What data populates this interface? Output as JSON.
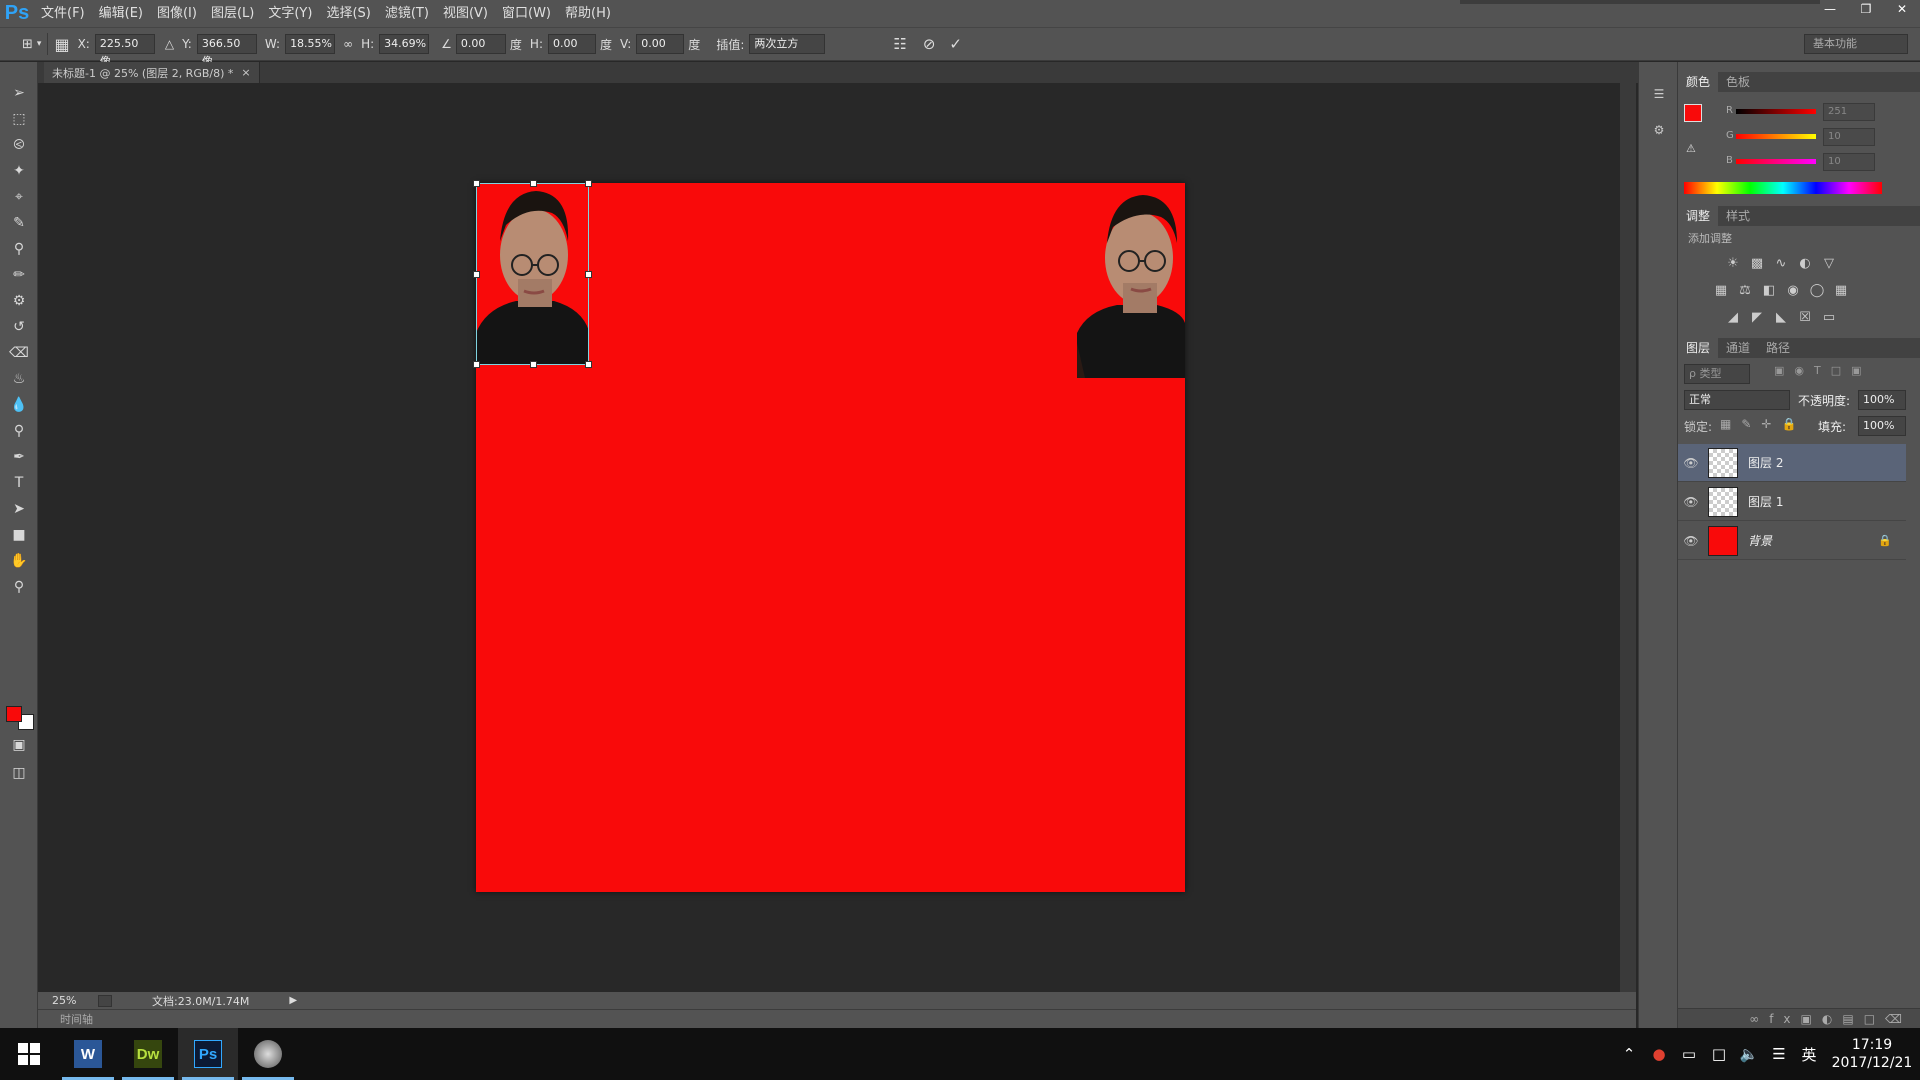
{
  "app": {
    "logo": "Ps"
  },
  "menu": [
    "文件(F)",
    "编辑(E)",
    "图像(I)",
    "图层(L)",
    "文字(Y)",
    "选择(S)",
    "滤镜(T)",
    "视图(V)",
    "窗口(W)",
    "帮助(H)"
  ],
  "options": {
    "x_label": "X:",
    "x_value": "225.50 像",
    "y_label": "Y:",
    "y_value": "366.50 像",
    "w_label": "W:",
    "w_value": "18.55%",
    "h_label": "H:",
    "h_value": "34.69%",
    "angle_value": "0.00",
    "angle_unit": "度",
    "hskew_label": "H:",
    "hskew_value": "0.00",
    "hskew_unit": "度",
    "vskew_label": "V:",
    "vskew_value": "0.00",
    "vskew_unit": "度",
    "interp_label": "插值:",
    "interp_value": "两次立方",
    "workspace": "基本功能"
  },
  "document": {
    "tab_title": "未标题-1 @ 25% (图层 2, RGB/8) *",
    "tab_close": "×"
  },
  "status": {
    "zoom": "25%",
    "doc_info": "文档:23.0M/1.74M",
    "timeline": "时间轴"
  },
  "color_panel": {
    "tabs": [
      "颜色",
      "色板"
    ],
    "r_label": "R",
    "r_value": "251",
    "g_label": "G",
    "g_value": "10",
    "b_label": "B",
    "b_value": "10",
    "fg_color": "#f90a0a"
  },
  "adjust_panel": {
    "tabs": [
      "调整",
      "样式"
    ],
    "heading": "添加调整"
  },
  "layers_panel": {
    "tabs": [
      "图层",
      "通道",
      "路径"
    ],
    "filter_label": "ρ 类型",
    "blend_mode": "正常",
    "opacity_label": "不透明度:",
    "opacity_value": "100%",
    "lock_label": "锁定:",
    "fill_label": "填充:",
    "fill_value": "100%",
    "layers": [
      {
        "name": "图层 2"
      },
      {
        "name": "图层 1"
      },
      {
        "name": "背景"
      }
    ]
  },
  "taskbar": {
    "apps": [
      {
        "label": "W",
        "icon": "word-icon"
      },
      {
        "label": "Dw",
        "icon": "dreamweaver-icon"
      },
      {
        "label": "Ps",
        "icon": "photoshop-icon"
      },
      {
        "label": "",
        "icon": "globe-icon"
      }
    ],
    "ime": "英",
    "time": "17:19",
    "date": "2017/12/21"
  }
}
